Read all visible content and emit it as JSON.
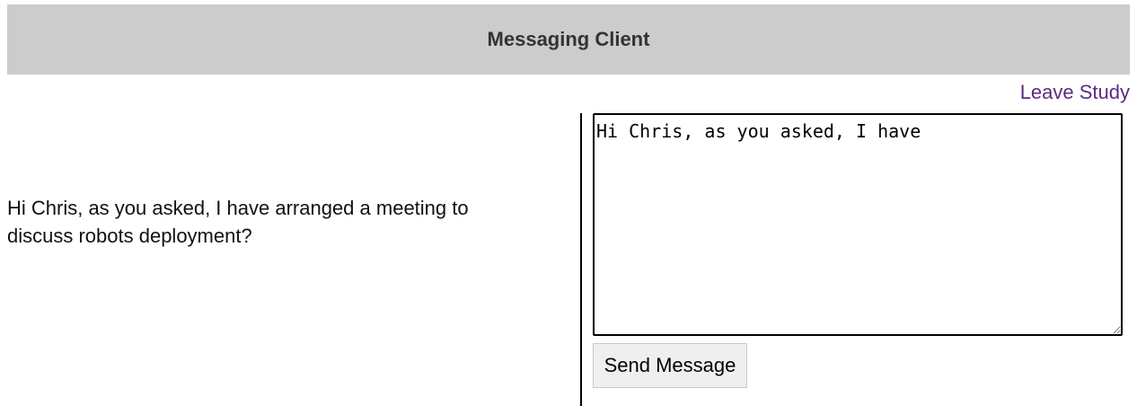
{
  "header": {
    "title": "Messaging Client"
  },
  "nav": {
    "leave_label": "Leave Study"
  },
  "prompt": {
    "text": "Hi Chris, as you asked, I have arranged a meeting to discuss robots deployment?"
  },
  "composer": {
    "value": "Hi Chris, as you asked, I have",
    "send_label": "Send Message"
  },
  "colors": {
    "header_bg": "#cccccc",
    "link": "#5b2c82"
  }
}
